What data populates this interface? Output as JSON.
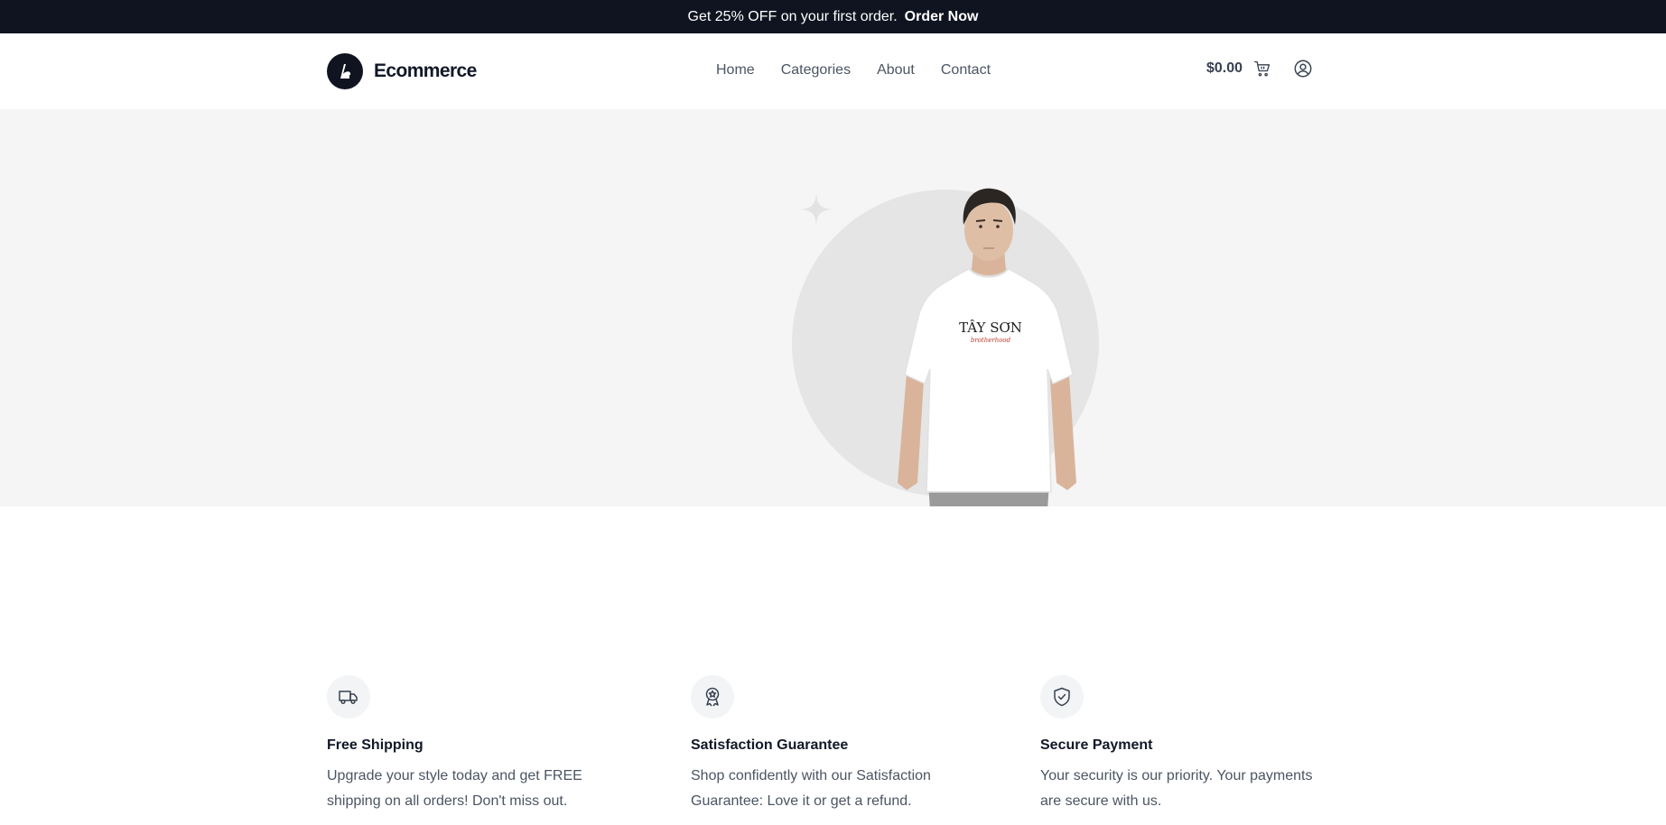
{
  "announcement": {
    "text": "Get 25% OFF on your first order.",
    "link": "Order Now"
  },
  "header": {
    "brand": "Ecommerce",
    "nav": [
      "Home",
      "Categories",
      "About",
      "Contact"
    ],
    "cart_total": "$0.00"
  },
  "hero": {
    "shirt_text": "TÂY SƠN",
    "shirt_subtext": "brotherhood"
  },
  "features": [
    {
      "icon": "truck-icon",
      "title": "Free Shipping",
      "description": "Upgrade your style today and get FREE shipping on all orders! Don't miss out."
    },
    {
      "icon": "award-icon",
      "title": "Satisfaction Guarantee",
      "description": "Shop confidently with our Satisfaction Guarantee: Love it or get a refund."
    },
    {
      "icon": "shield-check-icon",
      "title": "Secure Payment",
      "description": "Your security is our priority. Your payments are secure with us."
    }
  ],
  "colors": {
    "topbar": "#0f1420",
    "hero_bg": "#f5f5f5",
    "circle": "#e5e5e5",
    "text_muted": "#4b5563"
  }
}
